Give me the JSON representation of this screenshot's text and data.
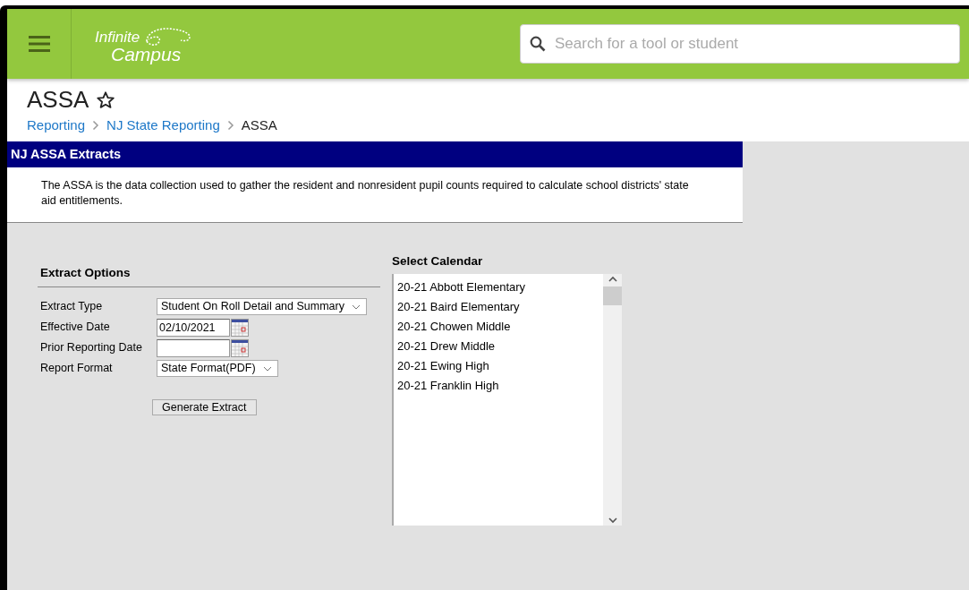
{
  "header": {
    "logo_line_1": "Infinite",
    "logo_line_2": "Campus",
    "search": {
      "placeholder": "Search for a tool or student"
    }
  },
  "page": {
    "title": "ASSA",
    "favorite": false,
    "breadcrumbs": [
      {
        "label": "Reporting",
        "link": true
      },
      {
        "label": "NJ State Reporting",
        "link": true
      },
      {
        "label": "ASSA",
        "link": false
      }
    ]
  },
  "panel": {
    "title": "NJ ASSA Extracts",
    "description": "The ASSA is the data collection used to gather the resident and nonresident pupil counts required to calculate school districts' state aid entitlements."
  },
  "extract_options": {
    "title": "Extract Options",
    "fields": [
      {
        "label": "Extract Type",
        "kind": "select",
        "value": "Student On Roll Detail and Summary"
      },
      {
        "label": "Effective Date",
        "kind": "date",
        "value": "02/10/2021"
      },
      {
        "label": "Prior Reporting Date",
        "kind": "date"
      },
      {
        "label": "Report Format",
        "kind": "select",
        "value": "State Format(PDF)"
      }
    ],
    "button": "Generate Extract"
  },
  "calendar": {
    "title": "Select Calendar",
    "items": [
      {
        "label": "20-21 Abbott Elementary",
        "selected": false
      },
      {
        "label": "20-21 Baird Elementary",
        "selected": false
      },
      {
        "label": "20-21 Chowen Middle",
        "selected": false
      },
      {
        "label": "20-21 Drew Middle",
        "selected": false
      },
      {
        "label": "20-21 Ewing High",
        "selected": false
      },
      {
        "label": "20-21 Franklin High",
        "selected": false
      }
    ]
  }
}
